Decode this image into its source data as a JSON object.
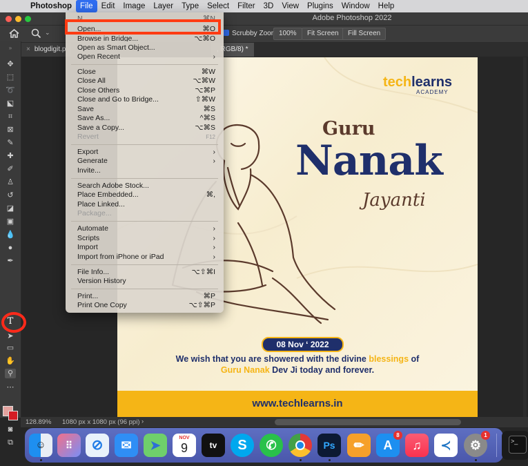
{
  "menubar": {
    "app": "Photoshop",
    "items": [
      "File",
      "Edit",
      "Image",
      "Layer",
      "Type",
      "Select",
      "Filter",
      "3D",
      "View",
      "Plugins",
      "Window",
      "Help"
    ]
  },
  "window": {
    "title": "Adobe Photoshop 2022"
  },
  "options": {
    "scrubby_zoom": "Scrubby Zoom",
    "zoom_100": "100%",
    "fit_screen": "Fit Screen",
    "fill_screen": "Fill Screen"
  },
  "tabs": [
    {
      "label": "blogdigit.p"
    },
    {
      "label": ", RGB/8) *"
    }
  ],
  "file_menu": {
    "partial_top": "N",
    "partial_top_shortcut": "⌘N",
    "items": [
      {
        "label": "Open...",
        "shortcut": "⌘O"
      },
      {
        "label": "Browse in Bridge...",
        "shortcut": "⌥⌘O"
      },
      {
        "label": "Open as Smart Object...",
        "shortcut": ""
      },
      {
        "label": "Open Recent",
        "shortcut": "",
        "submenu": true
      },
      {
        "label": "Close",
        "shortcut": "⌘W"
      },
      {
        "label": "Close All",
        "shortcut": "⌥⌘W"
      },
      {
        "label": "Close Others",
        "shortcut": "⌥⌘P"
      },
      {
        "label": "Close and Go to Bridge...",
        "shortcut": "⇧⌘W"
      },
      {
        "label": "Save",
        "shortcut": "⌘S"
      },
      {
        "label": "Save As...",
        "shortcut": "^⌘S"
      },
      {
        "label": "Save a Copy...",
        "shortcut": "⌥⌘S"
      },
      {
        "label": "Revert",
        "shortcut": "F12",
        "disabled": true
      },
      {
        "label": "Export",
        "shortcut": "",
        "submenu": true
      },
      {
        "label": "Generate",
        "shortcut": "",
        "submenu": true
      },
      {
        "label": "Invite...",
        "shortcut": ""
      },
      {
        "label": "Search Adobe Stock...",
        "shortcut": ""
      },
      {
        "label": "Place Embedded...",
        "shortcut": "⌘,"
      },
      {
        "label": "Place Linked...",
        "shortcut": ""
      },
      {
        "label": "Package...",
        "shortcut": "",
        "disabled": true
      },
      {
        "label": "Automate",
        "shortcut": "",
        "submenu": true
      },
      {
        "label": "Scripts",
        "shortcut": "",
        "submenu": true
      },
      {
        "label": "Import",
        "shortcut": "",
        "submenu": true
      },
      {
        "label": "Import from iPhone or iPad",
        "shortcut": "",
        "submenu": true
      },
      {
        "label": "File Info...",
        "shortcut": "⌥⇧⌘I"
      },
      {
        "label": "Version History",
        "shortcut": ""
      },
      {
        "label": "Print...",
        "shortcut": "⌘P"
      },
      {
        "label": "Print One Copy",
        "shortcut": "⌥⇧⌘P"
      }
    ],
    "submenu_arrow": "›"
  },
  "artwork": {
    "brand_main": "techlearns",
    "brand_sub": "ACADEMY",
    "heading_1": "Guru",
    "heading_2": "Nanak",
    "heading_3": "Jayanti",
    "date": "08 Nov ‘ 2022",
    "wish_1a": "We wish that you are showered with the divine ",
    "wish_1b": "blessings",
    "wish_1c": " of",
    "wish_2a": "Guru Nanak",
    "wish_2b": " Dev Ji today and forever.",
    "website": "www.techlearns.in"
  },
  "status": {
    "zoom": "128.89%",
    "doc_info": "1080 px x 1080 px (96 ppi)",
    "arrow": "›"
  },
  "dock": {
    "calendar_month": "NOV",
    "calendar_day": "9",
    "appletv": "tv",
    "skype": "S",
    "photoshop": "Ps",
    "appstore_badge": "8",
    "settings_badge": "1",
    "terminal": ">_"
  },
  "colors": {
    "accent": "#2f6df0",
    "highlight": "#ff3b12",
    "navy": "#1f2f6b",
    "gold": "#f5b516"
  }
}
